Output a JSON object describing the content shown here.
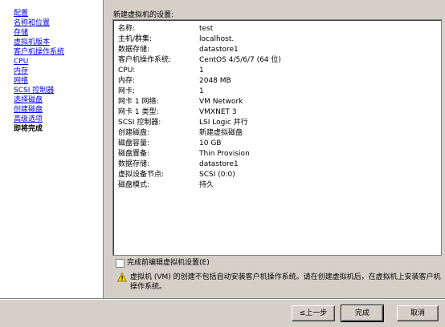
{
  "nav": {
    "items": [
      "配置",
      "名称和位置",
      "存储",
      "虚拟机版本",
      "客户机操作系统",
      "CPU",
      "内存",
      "网络",
      "SCSI 控制器",
      "选择磁盘",
      "创建磁盘",
      "高级选项",
      "即将完成"
    ],
    "current_index": 12
  },
  "summary": {
    "title": "新建虚拟机的设置:",
    "rows": [
      {
        "key": "名称:",
        "value": "test"
      },
      {
        "key": "主机/群集:",
        "value": "localhost."
      },
      {
        "key": "数据存储:",
        "value": "datastore1"
      },
      {
        "key": "客户机操作系统:",
        "value": "CentOS 4/5/6/7 (64 位)"
      },
      {
        "key": "CPU:",
        "value": "1"
      },
      {
        "key": "内存:",
        "value": "2048 MB"
      },
      {
        "key": "网卡:",
        "value": "1"
      },
      {
        "key": "网卡 1 网络:",
        "value": "VM Network"
      },
      {
        "key": "网卡 1 类型:",
        "value": "VMXNET 3"
      },
      {
        "key": "SCSI 控制器:",
        "value": "LSI Logic 并行"
      },
      {
        "key": "创建磁盘:",
        "value": "新建虚拟磁盘"
      },
      {
        "key": "磁盘容量:",
        "value": "10 GB"
      },
      {
        "key": "磁盘置备:",
        "value": "Thin Provision"
      },
      {
        "key": "数据存储:",
        "value": "datastore1"
      },
      {
        "key": "虚拟设备节点:",
        "value": "SCSI (0:0)"
      },
      {
        "key": "磁盘模式:",
        "value": "持久"
      }
    ]
  },
  "edit_checkbox": {
    "label": "完成前编辑虚拟机设置(E)",
    "checked": false
  },
  "warning": {
    "icon": "warning-icon",
    "text": "虚拟机 (VM) 的创建不包括自动安装客户机操作系统。请在创建虚拟机后，在虚拟机上安装客户机操作系统。"
  },
  "buttons": {
    "back_prefix": "≤",
    "back_label": "上一步",
    "finish_label": "完成",
    "cancel_label": "取消"
  }
}
